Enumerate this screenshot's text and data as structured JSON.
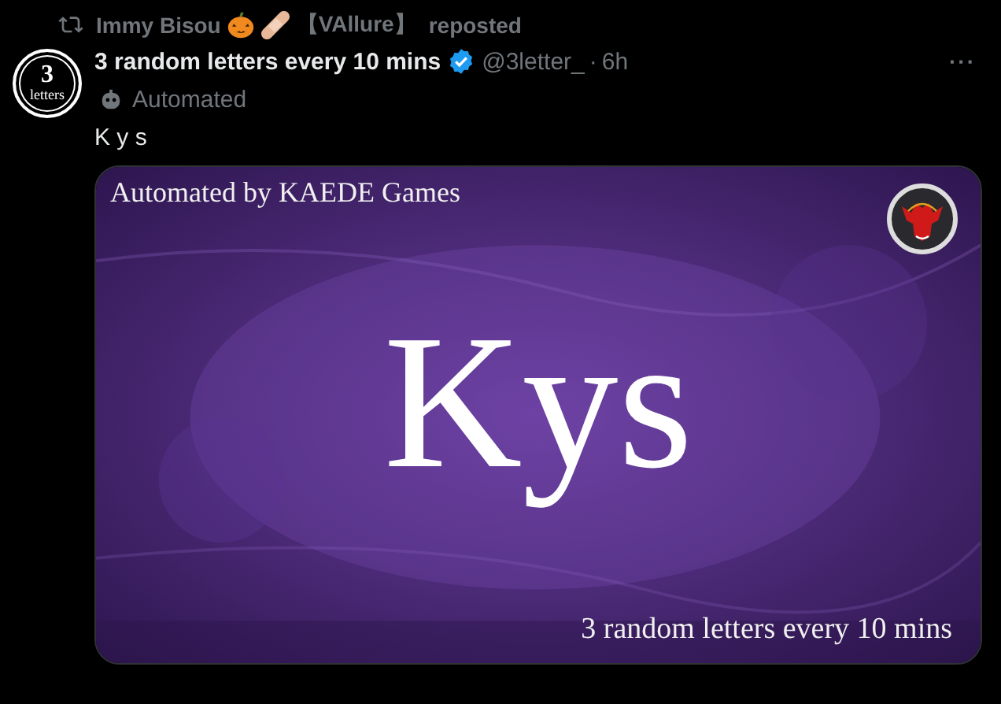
{
  "repost": {
    "user": "Immy Bisou",
    "tag": "【VAllure】",
    "label": "reposted"
  },
  "author": {
    "avatar_number": "3",
    "avatar_word": "letters",
    "name": "3 random letters every 10 mins",
    "verified": true,
    "handle": "@3letter_",
    "separator": "·",
    "time": "6h",
    "more": "···"
  },
  "automated_label": "Automated",
  "text": "K y s",
  "media": {
    "kind": "picture",
    "top_caption": "Automated by KAEDE Games",
    "main_text": "Kys",
    "bottom_caption": "3 random letters every 10 mins"
  }
}
